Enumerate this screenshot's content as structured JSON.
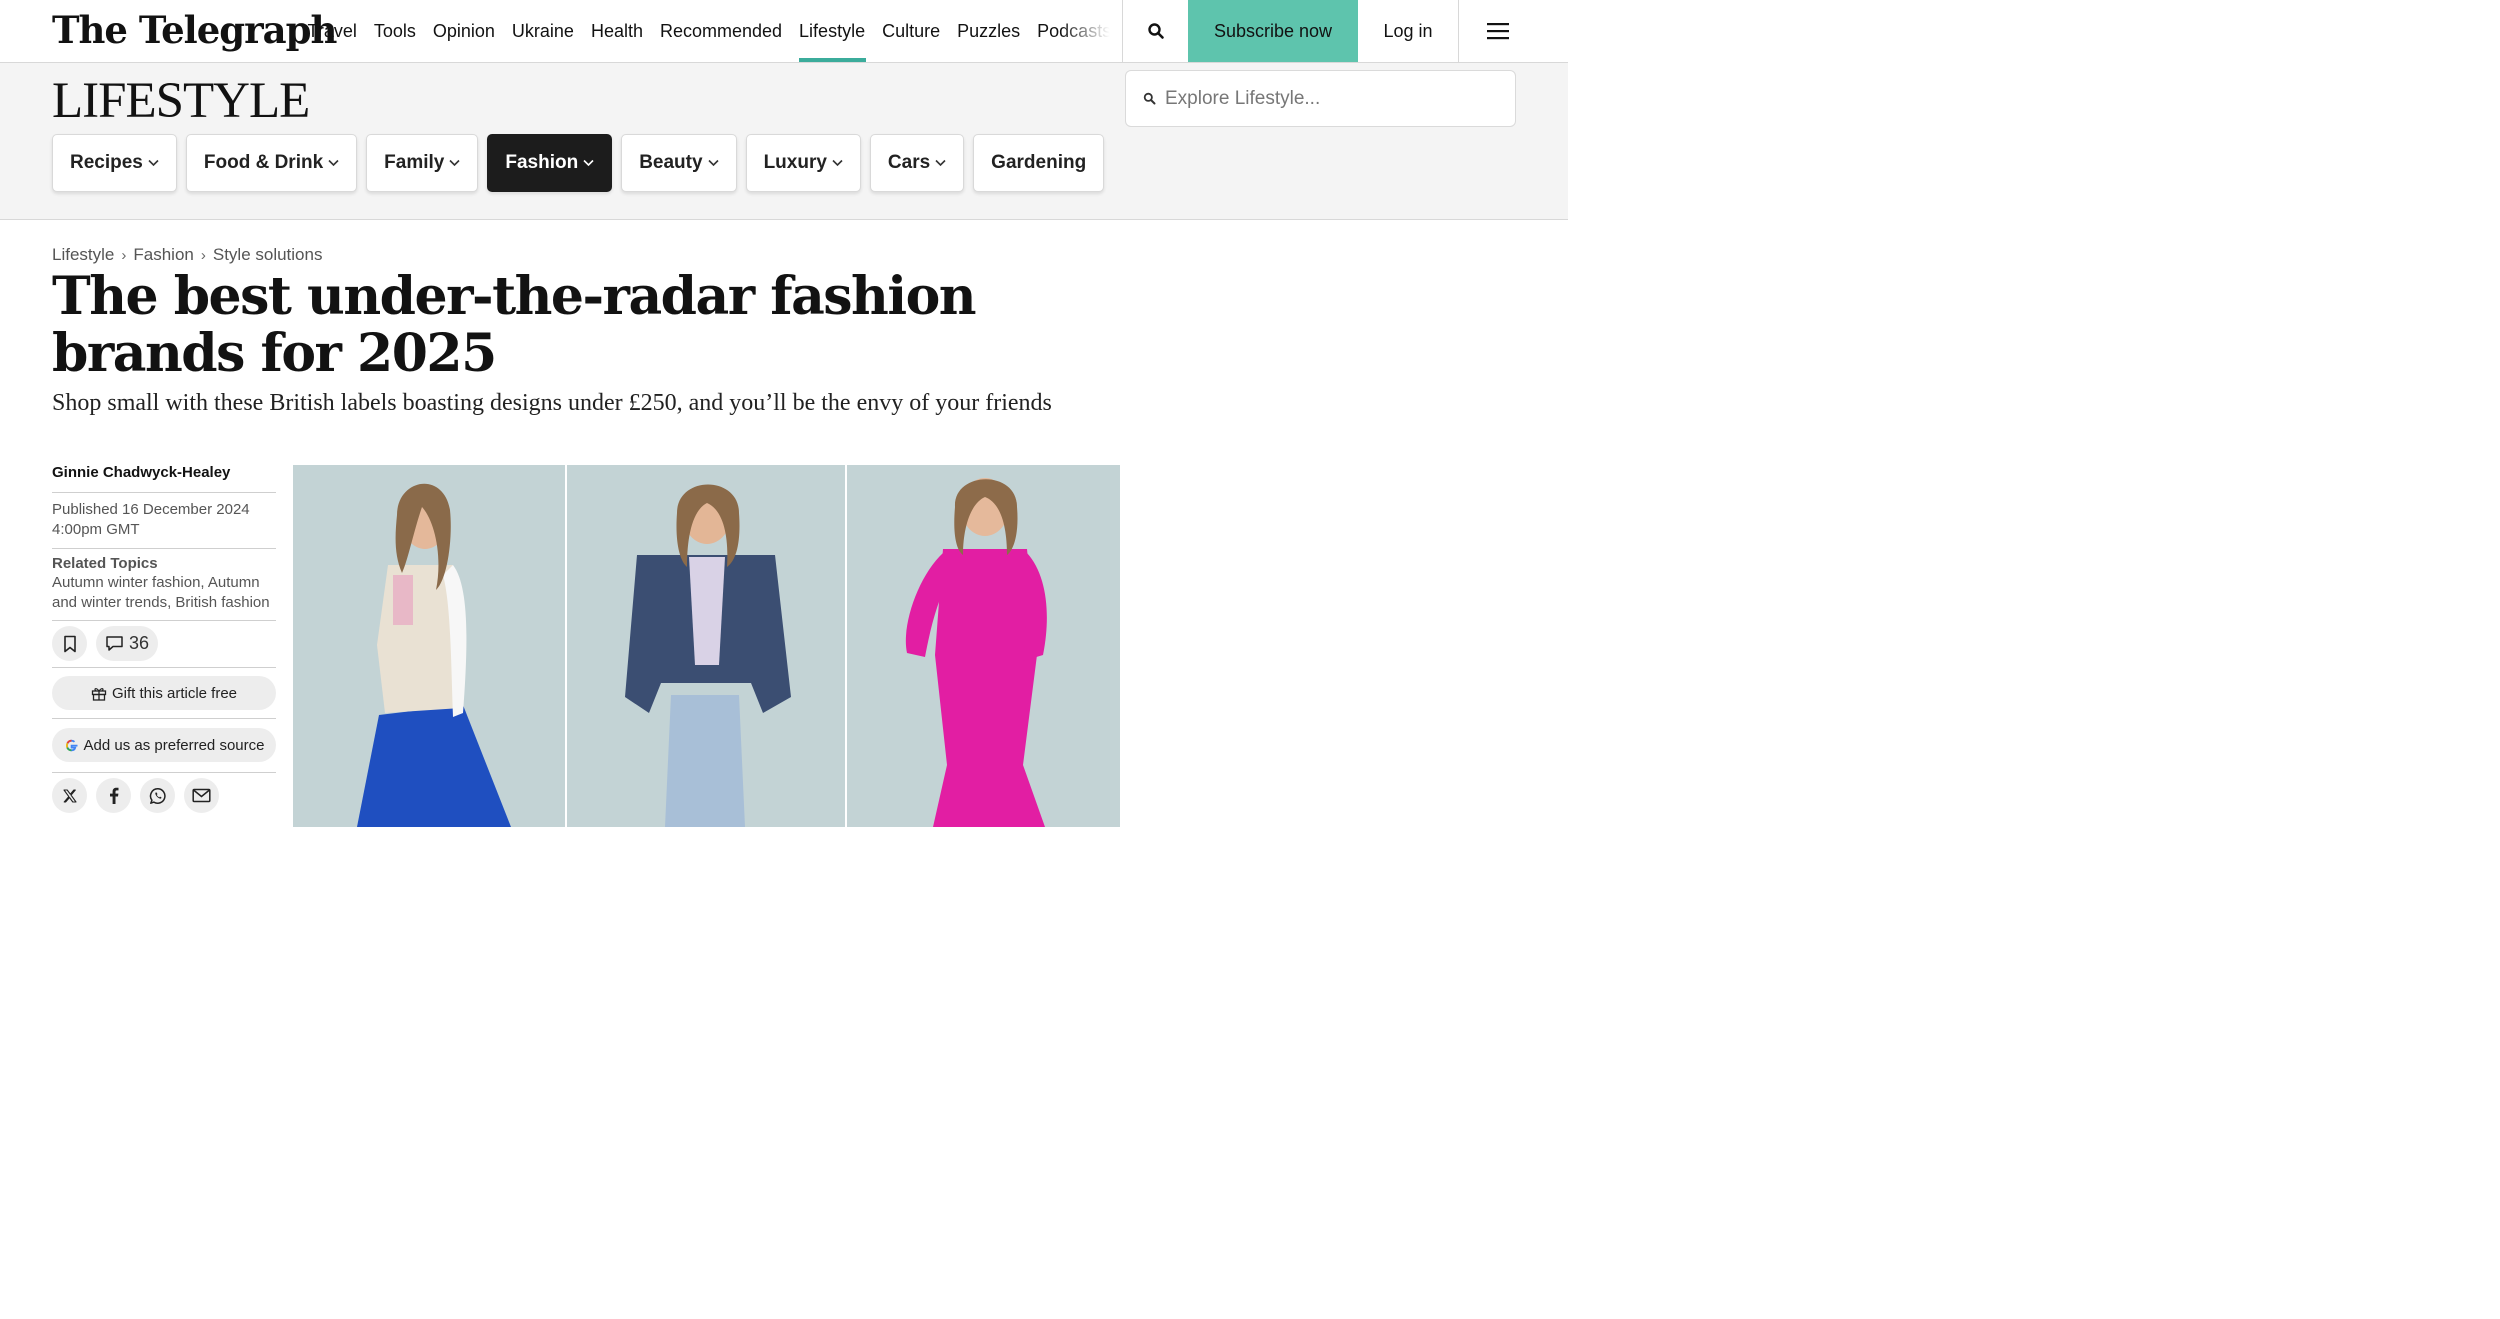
{
  "header": {
    "logo": "The Telegraph",
    "nav": [
      "Travel",
      "Tools",
      "Opinion",
      "Ukraine",
      "Health",
      "Recommended",
      "Lifestyle",
      "Culture",
      "Puzzles",
      "Podcasts"
    ],
    "active_nav": "Lifestyle",
    "subscribe_label": "Subscribe now",
    "login_label": "Log in",
    "accent_color": "#5ec4ad"
  },
  "section": {
    "title": "LIFESTYLE",
    "search_placeholder": "Explore Lifestyle...",
    "subnav": [
      {
        "label": "Recipes",
        "dropdown": true
      },
      {
        "label": "Food & Drink",
        "dropdown": true
      },
      {
        "label": "Family",
        "dropdown": true
      },
      {
        "label": "Fashion",
        "dropdown": true,
        "active": true
      },
      {
        "label": "Beauty",
        "dropdown": true
      },
      {
        "label": "Luxury",
        "dropdown": true
      },
      {
        "label": "Cars",
        "dropdown": true
      },
      {
        "label": "Gardening",
        "dropdown": false
      }
    ]
  },
  "article": {
    "breadcrumb": [
      "Lifestyle",
      "Fashion",
      "Style solutions"
    ],
    "headline": "The best under-the-radar fashion brands for 2025",
    "standfirst": "Shop small with these British labels boasting designs under £250, and you’ll be the envy of your friends",
    "author": "Ginnie Chadwyck-Healey",
    "published_line1": "Published 16 December 2024",
    "published_line2": "4:00pm GMT",
    "related_topics_label": "Related Topics",
    "related_topics": "Autumn winter fashion, Autumn and winter trends, British fashion",
    "comment_count": "36",
    "gift_label": "Gift this article free",
    "preferred_source_label": "Add us as preferred source",
    "share_icons": [
      "x-icon",
      "facebook-icon",
      "whatsapp-icon",
      "email-icon"
    ]
  }
}
